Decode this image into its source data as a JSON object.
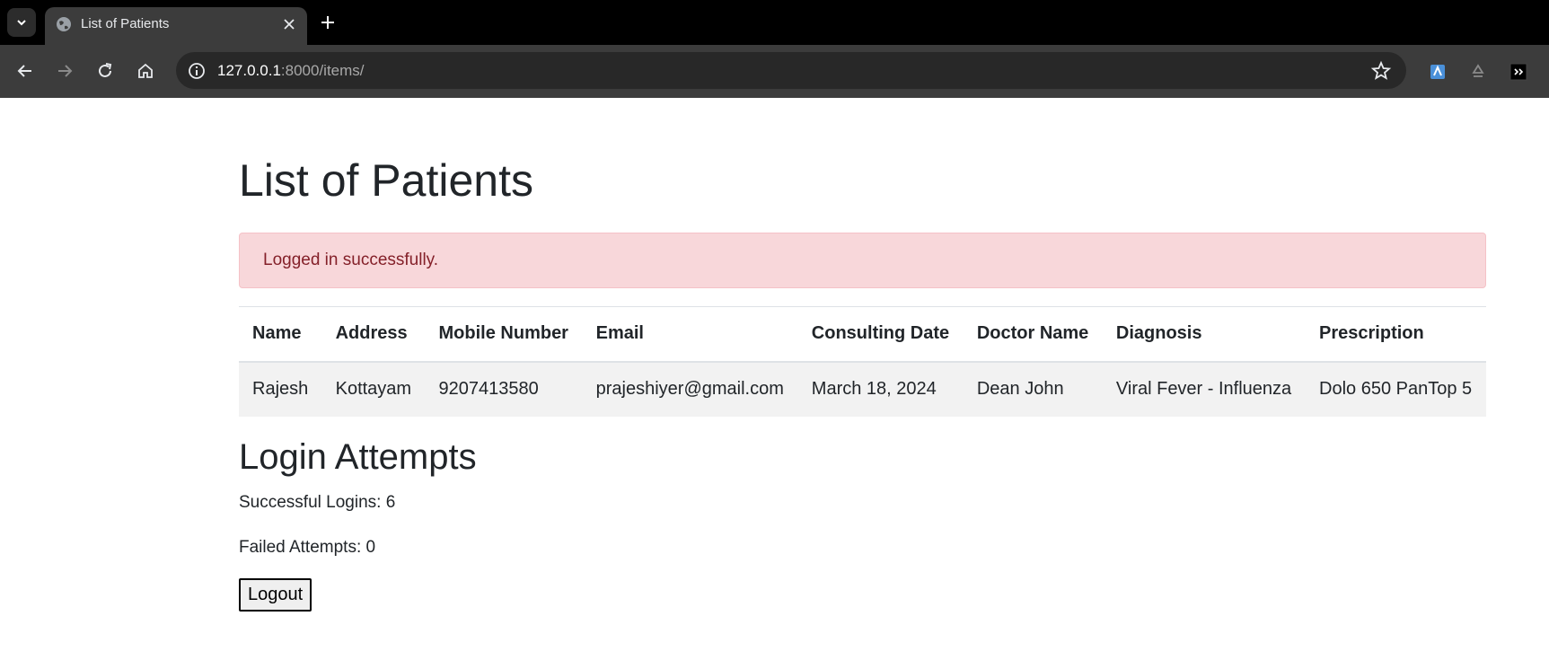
{
  "browser": {
    "tab_title": "List of Patients",
    "url_host": "127.0.0.1",
    "url_rest": ":8000/items/"
  },
  "page": {
    "title": "List of Patients",
    "alert": "Logged in successfully.",
    "table": {
      "headers": [
        "Name",
        "Address",
        "Mobile Number",
        "Email",
        "Consulting Date",
        "Doctor Name",
        "Diagnosis",
        "Prescription"
      ],
      "rows": [
        [
          "Rajesh",
          "Kottayam",
          "9207413580",
          "prajeshiyer@gmail.com",
          "March 18, 2024",
          "Dean John",
          "Viral Fever - Influenza",
          "Dolo 650 PanTop 5"
        ]
      ]
    },
    "login_attempts": {
      "title": "Login Attempts",
      "successful": "Successful Logins: 6",
      "failed": "Failed Attempts: 0"
    },
    "logout_label": "Logout"
  },
  "colors": {
    "alert_bg": "#f8d7da",
    "alert_text": "#842029",
    "row_bg": "#f2f2f2"
  },
  "icons": [
    "tab-search-icon",
    "globe-icon",
    "close-icon",
    "plus-icon",
    "back-icon",
    "forward-icon",
    "reload-icon",
    "home-icon",
    "info-icon",
    "star-icon",
    "extension-icon"
  ]
}
